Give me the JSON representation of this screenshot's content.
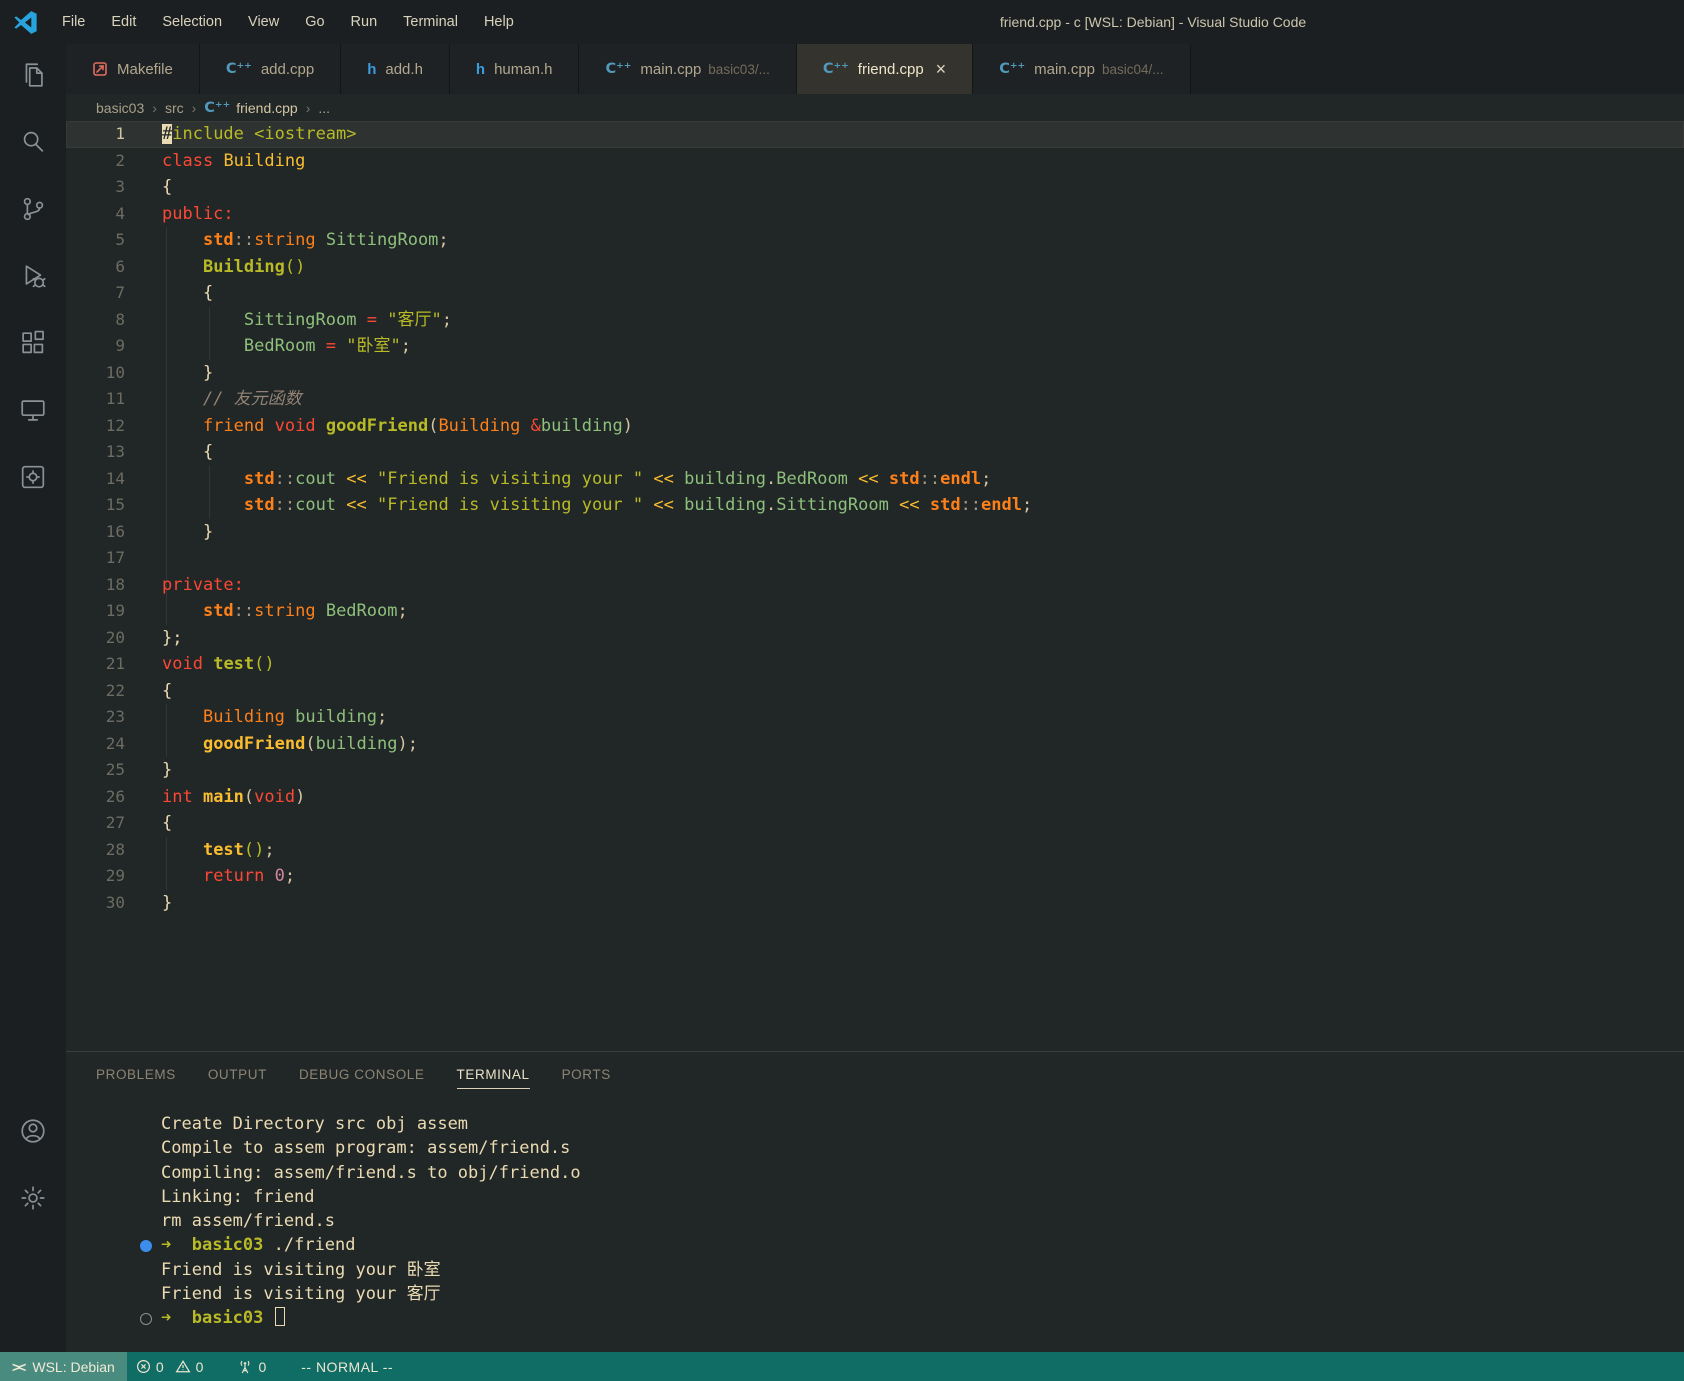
{
  "window": {
    "title": "friend.cpp - c [WSL: Debian] - Visual Studio Code"
  },
  "menu": [
    "File",
    "Edit",
    "Selection",
    "View",
    "Go",
    "Run",
    "Terminal",
    "Help"
  ],
  "activity_bar": {
    "top": [
      "explorer",
      "search",
      "source-control",
      "run-debug",
      "extensions",
      "remote-explorer",
      "makefile-tools"
    ],
    "bottom": [
      "account",
      "settings"
    ]
  },
  "tabs": [
    {
      "icon": "makefile",
      "label": "Makefile"
    },
    {
      "icon": "cpp",
      "label": "add.cpp"
    },
    {
      "icon": "h",
      "label": "add.h"
    },
    {
      "icon": "h",
      "label": "human.h"
    },
    {
      "icon": "cpp",
      "label": "main.cpp",
      "detail": "basic03/..."
    },
    {
      "icon": "cpp",
      "label": "friend.cpp",
      "active": true,
      "close_label": "×"
    },
    {
      "icon": "cpp",
      "label": "main.cpp",
      "detail": "basic04/..."
    }
  ],
  "breadcrumb_separator": "›",
  "breadcrumb": [
    {
      "label": "basic03"
    },
    {
      "label": "src"
    },
    {
      "label": "friend.cpp",
      "icon": "cpp",
      "last": true
    },
    {
      "label": "..."
    }
  ],
  "colors": {
    "red": "#fb4934",
    "orange": "#fe8019",
    "yellow": "#fabd2f",
    "green": "#b8bb26",
    "aqua": "#8ec07c",
    "purple": "#d3869b",
    "fg": "#ebdbb2",
    "punct": "#d5c4a1",
    "gray": "#a89984",
    "comment": "#928374"
  },
  "editor": {
    "lines": [
      {
        "n": 1,
        "current": true,
        "tokens": [
          {
            "t": "#",
            "s": "cursor"
          },
          {
            "t": "include",
            "c": "green"
          },
          {
            "t": " ",
            "c": "fg"
          },
          {
            "t": "<iostream>",
            "c": "green"
          }
        ]
      },
      {
        "n": 2,
        "tokens": [
          {
            "t": "class",
            "c": "red"
          },
          {
            "t": " ",
            "c": "fg"
          },
          {
            "t": "Building",
            "c": "yellow"
          }
        ]
      },
      {
        "n": 3,
        "tokens": [
          {
            "t": "{",
            "c": "fg"
          }
        ]
      },
      {
        "n": 4,
        "tokens": [
          {
            "t": "public:",
            "c": "red"
          }
        ]
      },
      {
        "n": 5,
        "tokens": [
          {
            "t": "    ",
            "c": "fg"
          },
          {
            "t": "std",
            "c": "orange",
            "s": "b"
          },
          {
            "t": "::",
            "c": "gray"
          },
          {
            "t": "string",
            "c": "orange"
          },
          {
            "t": " ",
            "c": "fg"
          },
          {
            "t": "SittingRoom",
            "c": "aqua"
          },
          {
            "t": ";",
            "c": "punct"
          }
        ]
      },
      {
        "n": 6,
        "tokens": [
          {
            "t": "    ",
            "c": "fg"
          },
          {
            "t": "Building",
            "c": "green",
            "s": "b"
          },
          {
            "t": "()",
            "c": "green"
          }
        ]
      },
      {
        "n": 7,
        "tokens": [
          {
            "t": "    {",
            "c": "fg"
          }
        ]
      },
      {
        "n": 8,
        "tokens": [
          {
            "t": "        ",
            "c": "fg"
          },
          {
            "t": "SittingRoom",
            "c": "aqua"
          },
          {
            "t": " ",
            "c": "fg"
          },
          {
            "t": "=",
            "c": "red"
          },
          {
            "t": " ",
            "c": "fg"
          },
          {
            "t": "\"客厅\"",
            "c": "green"
          },
          {
            "t": ";",
            "c": "punct"
          }
        ]
      },
      {
        "n": 9,
        "tokens": [
          {
            "t": "        ",
            "c": "fg"
          },
          {
            "t": "BedRoom",
            "c": "aqua"
          },
          {
            "t": " ",
            "c": "fg"
          },
          {
            "t": "=",
            "c": "red"
          },
          {
            "t": " ",
            "c": "fg"
          },
          {
            "t": "\"卧室\"",
            "c": "green"
          },
          {
            "t": ";",
            "c": "punct"
          }
        ]
      },
      {
        "n": 10,
        "tokens": [
          {
            "t": "    }",
            "c": "fg"
          }
        ]
      },
      {
        "n": 11,
        "tokens": [
          {
            "t": "    ",
            "c": "fg"
          },
          {
            "t": "// 友元函数",
            "c": "comment",
            "s": "i"
          }
        ]
      },
      {
        "n": 12,
        "tokens": [
          {
            "t": "    ",
            "c": "fg"
          },
          {
            "t": "friend",
            "c": "orange"
          },
          {
            "t": " ",
            "c": "fg"
          },
          {
            "t": "void",
            "c": "red"
          },
          {
            "t": " ",
            "c": "fg"
          },
          {
            "t": "goodFriend",
            "c": "green",
            "s": "b"
          },
          {
            "t": "(",
            "c": "punct"
          },
          {
            "t": "Building",
            "c": "orange"
          },
          {
            "t": " ",
            "c": "fg"
          },
          {
            "t": "&",
            "c": "red"
          },
          {
            "t": "building",
            "c": "aqua"
          },
          {
            "t": ")",
            "c": "punct"
          }
        ]
      },
      {
        "n": 13,
        "tokens": [
          {
            "t": "    {",
            "c": "fg"
          }
        ]
      },
      {
        "n": 14,
        "tokens": [
          {
            "t": "        ",
            "c": "fg"
          },
          {
            "t": "std",
            "c": "orange",
            "s": "b"
          },
          {
            "t": "::",
            "c": "gray"
          },
          {
            "t": "cout",
            "c": "aqua"
          },
          {
            "t": " ",
            "c": "fg"
          },
          {
            "t": "<<",
            "c": "yellow"
          },
          {
            "t": " ",
            "c": "fg"
          },
          {
            "t": "\"Friend is visiting your \"",
            "c": "green"
          },
          {
            "t": " ",
            "c": "fg"
          },
          {
            "t": "<<",
            "c": "yellow"
          },
          {
            "t": " ",
            "c": "fg"
          },
          {
            "t": "building",
            "c": "aqua"
          },
          {
            "t": ".",
            "c": "punct"
          },
          {
            "t": "BedRoom",
            "c": "aqua"
          },
          {
            "t": " ",
            "c": "fg"
          },
          {
            "t": "<<",
            "c": "yellow"
          },
          {
            "t": " ",
            "c": "fg"
          },
          {
            "t": "std",
            "c": "orange",
            "s": "b"
          },
          {
            "t": "::",
            "c": "gray"
          },
          {
            "t": "endl",
            "c": "orange",
            "s": "b"
          },
          {
            "t": ";",
            "c": "punct"
          }
        ]
      },
      {
        "n": 15,
        "tokens": [
          {
            "t": "        ",
            "c": "fg"
          },
          {
            "t": "std",
            "c": "orange",
            "s": "b"
          },
          {
            "t": "::",
            "c": "gray"
          },
          {
            "t": "cout",
            "c": "aqua"
          },
          {
            "t": " ",
            "c": "fg"
          },
          {
            "t": "<<",
            "c": "yellow"
          },
          {
            "t": " ",
            "c": "fg"
          },
          {
            "t": "\"Friend is visiting your \"",
            "c": "green"
          },
          {
            "t": " ",
            "c": "fg"
          },
          {
            "t": "<<",
            "c": "yellow"
          },
          {
            "t": " ",
            "c": "fg"
          },
          {
            "t": "building",
            "c": "aqua"
          },
          {
            "t": ".",
            "c": "punct"
          },
          {
            "t": "SittingRoom",
            "c": "aqua"
          },
          {
            "t": " ",
            "c": "fg"
          },
          {
            "t": "<<",
            "c": "yellow"
          },
          {
            "t": " ",
            "c": "fg"
          },
          {
            "t": "std",
            "c": "orange",
            "s": "b"
          },
          {
            "t": "::",
            "c": "gray"
          },
          {
            "t": "endl",
            "c": "orange",
            "s": "b"
          },
          {
            "t": ";",
            "c": "punct"
          }
        ]
      },
      {
        "n": 16,
        "tokens": [
          {
            "t": "    }",
            "c": "fg"
          }
        ]
      },
      {
        "n": 17,
        "tokens": []
      },
      {
        "n": 18,
        "tokens": [
          {
            "t": "private:",
            "c": "red"
          }
        ]
      },
      {
        "n": 19,
        "tokens": [
          {
            "t": "    ",
            "c": "fg"
          },
          {
            "t": "std",
            "c": "orange",
            "s": "b"
          },
          {
            "t": "::",
            "c": "gray"
          },
          {
            "t": "string",
            "c": "orange"
          },
          {
            "t": " ",
            "c": "fg"
          },
          {
            "t": "BedRoom",
            "c": "aqua"
          },
          {
            "t": ";",
            "c": "punct"
          }
        ]
      },
      {
        "n": 20,
        "tokens": [
          {
            "t": "};",
            "c": "fg"
          }
        ]
      },
      {
        "n": 21,
        "tokens": [
          {
            "t": "void",
            "c": "red"
          },
          {
            "t": " ",
            "c": "fg"
          },
          {
            "t": "test",
            "c": "green",
            "s": "b"
          },
          {
            "t": "()",
            "c": "green"
          }
        ]
      },
      {
        "n": 22,
        "tokens": [
          {
            "t": "{",
            "c": "fg"
          }
        ]
      },
      {
        "n": 23,
        "tokens": [
          {
            "t": "    ",
            "c": "fg"
          },
          {
            "t": "Building",
            "c": "orange"
          },
          {
            "t": " ",
            "c": "fg"
          },
          {
            "t": "building",
            "c": "aqua"
          },
          {
            "t": ";",
            "c": "punct"
          }
        ]
      },
      {
        "n": 24,
        "tokens": [
          {
            "t": "    ",
            "c": "fg"
          },
          {
            "t": "goodFriend",
            "c": "yellow",
            "s": "b"
          },
          {
            "t": "(",
            "c": "punct"
          },
          {
            "t": "building",
            "c": "aqua"
          },
          {
            "t": ");",
            "c": "punct"
          }
        ]
      },
      {
        "n": 25,
        "tokens": [
          {
            "t": "}",
            "c": "fg"
          }
        ]
      },
      {
        "n": 26,
        "tokens": [
          {
            "t": "int",
            "c": "red"
          },
          {
            "t": " ",
            "c": "fg"
          },
          {
            "t": "main",
            "c": "yellow",
            "s": "b"
          },
          {
            "t": "(",
            "c": "punct"
          },
          {
            "t": "void",
            "c": "red"
          },
          {
            "t": ")",
            "c": "punct"
          }
        ]
      },
      {
        "n": 27,
        "tokens": [
          {
            "t": "{",
            "c": "fg"
          }
        ]
      },
      {
        "n": 28,
        "tokens": [
          {
            "t": "    ",
            "c": "fg"
          },
          {
            "t": "test",
            "c": "yellow",
            "s": "b"
          },
          {
            "t": "()",
            "c": "green"
          },
          {
            "t": ";",
            "c": "punct"
          }
        ]
      },
      {
        "n": 29,
        "tokens": [
          {
            "t": "    ",
            "c": "fg"
          },
          {
            "t": "return",
            "c": "red"
          },
          {
            "t": " ",
            "c": "fg"
          },
          {
            "t": "0",
            "c": "purple"
          },
          {
            "t": ";",
            "c": "punct"
          }
        ]
      },
      {
        "n": 30,
        "tokens": [
          {
            "t": "}",
            "c": "fg"
          }
        ]
      }
    ]
  },
  "panel": {
    "tabs": [
      {
        "label": "PROBLEMS"
      },
      {
        "label": "OUTPUT"
      },
      {
        "label": "DEBUG CONSOLE"
      },
      {
        "label": "TERMINAL",
        "active": true
      },
      {
        "label": "PORTS"
      }
    ]
  },
  "terminal": {
    "lines": [
      {
        "tokens": [
          {
            "t": "Create Directory src obj assem",
            "c": "fg"
          }
        ]
      },
      {
        "tokens": [
          {
            "t": "Compile to assem program: assem/friend.s",
            "c": "fg"
          }
        ]
      },
      {
        "tokens": [
          {
            "t": "Compiling: assem/friend.s to obj/friend.o",
            "c": "fg"
          }
        ]
      },
      {
        "tokens": [
          {
            "t": "Linking: friend",
            "c": "fg"
          }
        ]
      },
      {
        "tokens": [
          {
            "t": "rm assem/friend.s",
            "c": "fg"
          }
        ]
      },
      {
        "deco": "filled",
        "tokens": [
          {
            "t": "➜",
            "c": "green",
            "s": "b"
          },
          {
            "t": "  ",
            "c": "fg"
          },
          {
            "t": "basic03",
            "c": "green",
            "s": "b"
          },
          {
            "t": " ./friend",
            "c": "fg"
          }
        ]
      },
      {
        "tokens": [
          {
            "t": "Friend is visiting your 卧室",
            "c": "fg"
          }
        ]
      },
      {
        "tokens": [
          {
            "t": "Friend is visiting your 客厅",
            "c": "fg"
          }
        ]
      },
      {
        "deco": "hollow",
        "tokens": [
          {
            "t": "➜",
            "c": "green",
            "s": "b"
          },
          {
            "t": "  ",
            "c": "fg"
          },
          {
            "t": "basic03",
            "c": "green",
            "s": "b"
          },
          {
            "t": " ",
            "c": "fg"
          },
          {
            "t": "",
            "s": "termcursor"
          }
        ]
      }
    ]
  },
  "status_bar": {
    "remote_label": "WSL: Debian",
    "errors": "0",
    "warnings": "0",
    "ports": "0",
    "mode": "-- NORMAL --"
  }
}
